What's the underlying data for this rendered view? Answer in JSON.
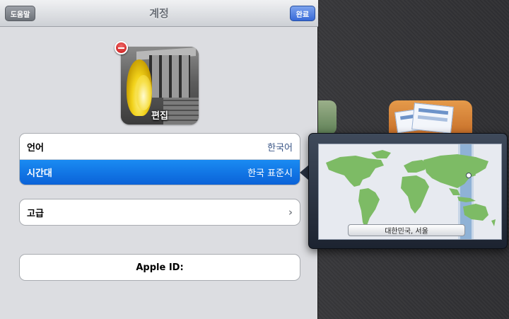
{
  "navbar": {
    "title": "계정",
    "help_label": "도움말",
    "done_label": "완료"
  },
  "profile": {
    "edit_label": "편집"
  },
  "settings": {
    "language": {
      "label": "언어",
      "value": "한국어"
    },
    "timezone": {
      "label": "시간대",
      "value": "한국 표준시"
    },
    "advanced": {
      "label": "고급"
    },
    "apple_id": {
      "label": "Apple ID:"
    }
  },
  "timezone_popover": {
    "city_label": "대한민국, 서울"
  },
  "colors": {
    "selected_row": "#0a62d8",
    "map_land": "#7dbb65",
    "timezone_band": "#8fb2d6"
  }
}
